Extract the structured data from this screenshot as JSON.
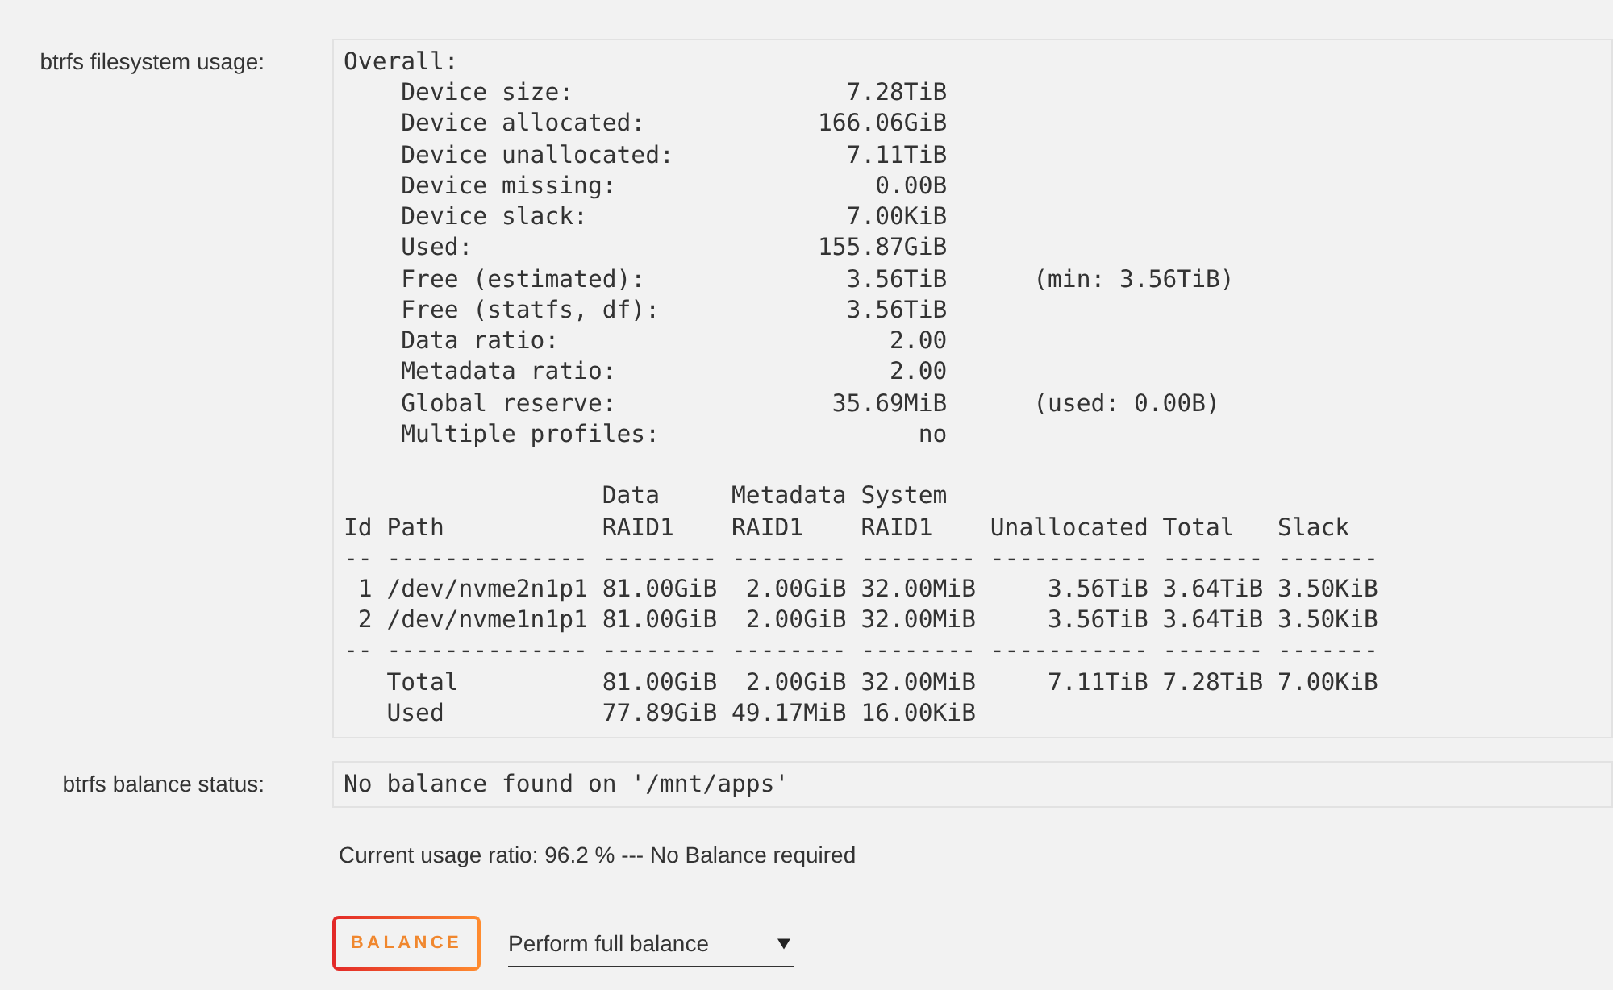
{
  "usage": {
    "label": "btrfs filesystem usage:",
    "output_blocks": [
      [
        "Overall:",
        "    Device size:                   7.28TiB",
        "    Device allocated:            166.06GiB",
        "    Device unallocated:            7.11TiB",
        "    Device missing:                  0.00B",
        "    Device slack:                  7.00KiB",
        "    Used:                        155.87GiB",
        "    Free (estimated):              3.56TiB      (min: 3.56TiB)",
        "    Free (statfs, df):             3.56TiB",
        "    Data ratio:                       2.00",
        "    Metadata ratio:                   2.00",
        "    Global reserve:               35.69MiB      (used: 0.00B)",
        "    Multiple profiles:                  no"
      ],
      [
        "                  Data     Metadata System",
        "Id Path           RAID1    RAID1    RAID1    Unallocated Total   Slack",
        "-- -------------- -------- -------- -------- ----------- ------- -------",
        " 1 /dev/nvme2n1p1 81.00GiB  2.00GiB 32.00MiB     3.56TiB 3.64TiB 3.50KiB",
        " 2 /dev/nvme1n1p1 81.00GiB  2.00GiB 32.00MiB     3.56TiB 3.64TiB 3.50KiB",
        "-- -------------- -------- -------- -------- ----------- ------- -------",
        "   Total          81.00GiB  2.00GiB 32.00MiB     7.11TiB 7.28TiB 7.00KiB",
        "   Used           77.89GiB 49.17MiB 16.00KiB"
      ]
    ]
  },
  "balance_status": {
    "label": "btrfs balance status:",
    "output": "No balance found on '/mnt/apps'"
  },
  "usage_ratio_note": "Current usage ratio: 96.2 % --- No Balance required",
  "balance_button": {
    "label": "BALANCE"
  },
  "balance_mode_select": {
    "value": "Perform full balance"
  }
}
